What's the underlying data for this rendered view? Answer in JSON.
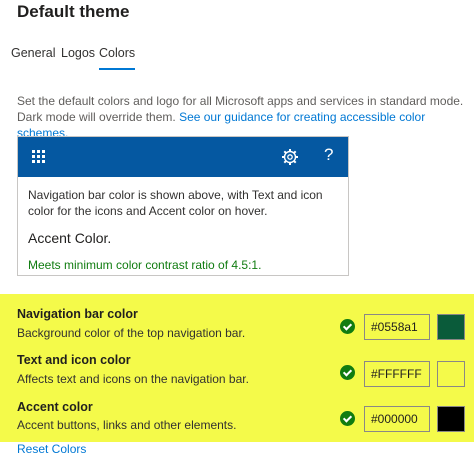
{
  "page": {
    "title": "Default theme"
  },
  "tabs": [
    {
      "label": "General"
    },
    {
      "label": "Logos"
    },
    {
      "label": "Colors"
    }
  ],
  "description": {
    "text": "Set the default colors and logo for all Microsoft apps and services in standard mode. Dark mode will override them.",
    "link": "See our guidance for creating accessible color schemes."
  },
  "preview": {
    "nav_color": "#0558a1",
    "help_symbol": "?",
    "text": "Navigation bar color is shown above, with Text and icon color for the icons and Accent color on hover.",
    "accent_label": "Accent Color.",
    "contrast_message": "Meets minimum color contrast ratio of 4.5:1."
  },
  "settings": [
    {
      "title": "Navigation bar color",
      "description": "Background color of the top navigation bar.",
      "value": "#0558a1",
      "swatch": "#0a5b3a"
    },
    {
      "title": "Text and icon color",
      "description": "Affects text and icons on the navigation bar.",
      "value": "#FFFFFF",
      "swatch": "#f4fa4a"
    },
    {
      "title": "Accent color",
      "description": "Accent buttons, links and other elements.",
      "value": "#000000",
      "swatch": "#000000"
    }
  ],
  "reset_label": "Reset Colors",
  "colors": {
    "highlight": "#f4fa4a",
    "link": "#0078d4",
    "success": "#107c10"
  }
}
